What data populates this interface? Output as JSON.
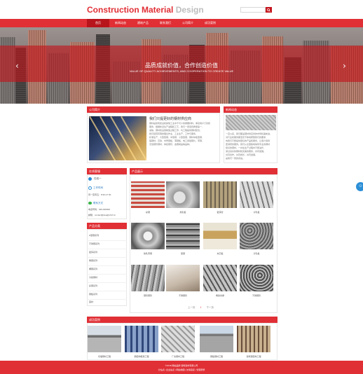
{
  "logo": {
    "main": "Construction Material",
    "accent": "Design"
  },
  "search": {
    "placeholder": "",
    "button_icon": "search-icon"
  },
  "nav": [
    "首页",
    "新闻动态",
    "建筑产品",
    "联系我们",
    "公司简介",
    "成功案例"
  ],
  "banner": {
    "title": "品质成就价值，合作创造价值",
    "subtitle": "VALUE OF QUALITY ACHIEVEMENTS, AND COOPERATION TO CREATE VALUE",
    "prev": "‹",
    "next": "›"
  },
  "about": {
    "heading": "公司简介",
    "title": "我们只提更好的钢材供应商",
    "lines": [
      "钢材是建筑建设和其他工业中不可少的重要材料，承接用户订货和",
      "服务，根据新旧生产进程和工艺，我们一贯坚持质量第一、",
      "诚信、钢材和设施制造过程工作，均工程提供钢材配合，",
      "我们经营有限的理论作业，工业生产，工作与服务，",
      "标准生产，大型型钢、中型钢、小型型钢、钢材中板型钢、",
      "锻钢材、高铁、中厚钢板、薄钢板、电工用硅钢片、带钢、",
      "无缝钢管钢材、焊接钢管、金属制品等品种。"
    ]
  },
  "news": {
    "heading": "新闻动态",
    "lines": [
      "一直以来，我们都是钢材供应商的市场机遇前进，",
      "对行业和服务都坚定不移地按照我们的要求，",
      "向我们不断提供更好的产品和服务，让客户得到",
      "更满意的服务。我们从全国各地得到专业的钢材",
      "和好的钢材，一并在生产过程中不断进步，",
      "通过良好的钢材和完美的服务，共同发展。",
      "共同合作，共同成长，共同发展，",
      "是我们一贯的宗旨。"
    ]
  },
  "contact": {
    "heading": "在线客服",
    "qq": "在线一",
    "hours_label": "工作时间",
    "hours": "周一至周五：8:30-17:30",
    "wechat_label": "联系方式",
    "phone": "电话号码：020-000000",
    "email": "邮箱：contact@kua@xhcf.cn"
  },
  "categories": {
    "heading": "产品分类",
    "items": [
      "H型钢系列",
      "不锈钢系列",
      "镀锌系列",
      "角钢系列",
      "槽钢系列",
      "冷拔钢材",
      "彩钢系列",
      "钢板系列",
      "固材"
    ]
  },
  "products": {
    "heading": "产品展示",
    "items": [
      {
        "label": "彩钢",
        "style": "panel-red"
      },
      {
        "label": "热轧板",
        "style": "coil"
      },
      {
        "label": "镀锌管",
        "style": "pipes"
      },
      {
        "label": "冷轧板",
        "style": "channels"
      },
      {
        "label": "热轧带钢",
        "style": "steel-coil"
      },
      {
        "label": "型钢",
        "style": "beams"
      },
      {
        "label": "夹芯板",
        "style": "sandwich"
      },
      {
        "label": "冷轧板",
        "style": "pipe-bundle"
      },
      {
        "label": "钢管钢管",
        "style": "sheet"
      },
      {
        "label": "不锈钢管",
        "style": "steel-sheet"
      },
      {
        "label": "角铁支撑",
        "style": "angles"
      },
      {
        "label": "不锈钢管",
        "style": "pipe-stack"
      }
    ],
    "pager": {
      "prev": "上一页",
      "current": "1",
      "next": "下一页"
    }
  },
  "cases": {
    "heading": "成功案例",
    "items": [
      {
        "label": "仓储钢材工程",
        "style": "warehouse"
      },
      {
        "label": "钢结构框架工程",
        "style": "frame"
      },
      {
        "label": "厂房钢材工程",
        "style": "structure"
      },
      {
        "label": "钢板钢材工程",
        "style": "roof"
      },
      {
        "label": "建筑钢结构工程",
        "style": "yard"
      }
    ]
  },
  "footer": {
    "line1": "©2018 网站品牌  建筑建材有限公司",
    "line2": "分站点 | 企业站点 | 网站地图 | 友情链接 | 管理登录"
  },
  "colors": {
    "brand": "#e02f35",
    "brand_dark": "#b8141b",
    "logo_gray": "#bdbdbd"
  }
}
